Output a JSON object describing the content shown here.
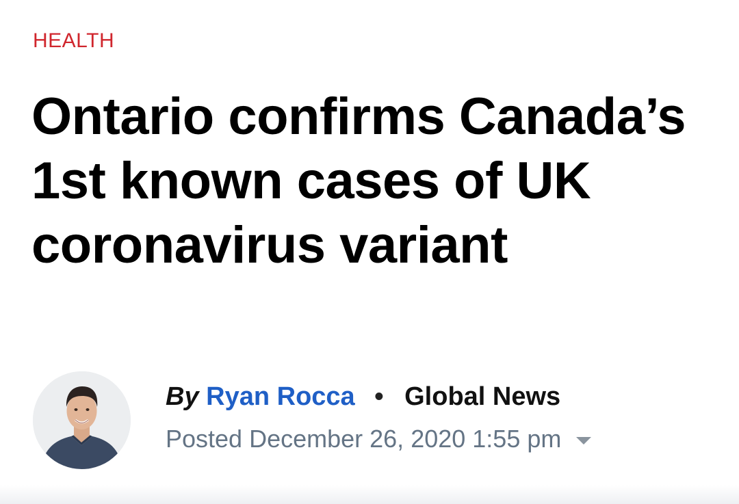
{
  "article": {
    "category": "HEALTH",
    "headline": "Ontario confirms Canada’s 1st known cases of UK coronavirus variant",
    "byline": {
      "by": "By",
      "author": "Ryan Rocca",
      "separator": "•",
      "source": "Global News"
    },
    "posted": "Posted December 26, 2020 1:55 pm",
    "expand_icon": "chevron-down-icon"
  },
  "colors": {
    "category": "#d0262d",
    "author_link": "#1f5fc6",
    "posted_text": "#647485",
    "headline": "#000000"
  }
}
